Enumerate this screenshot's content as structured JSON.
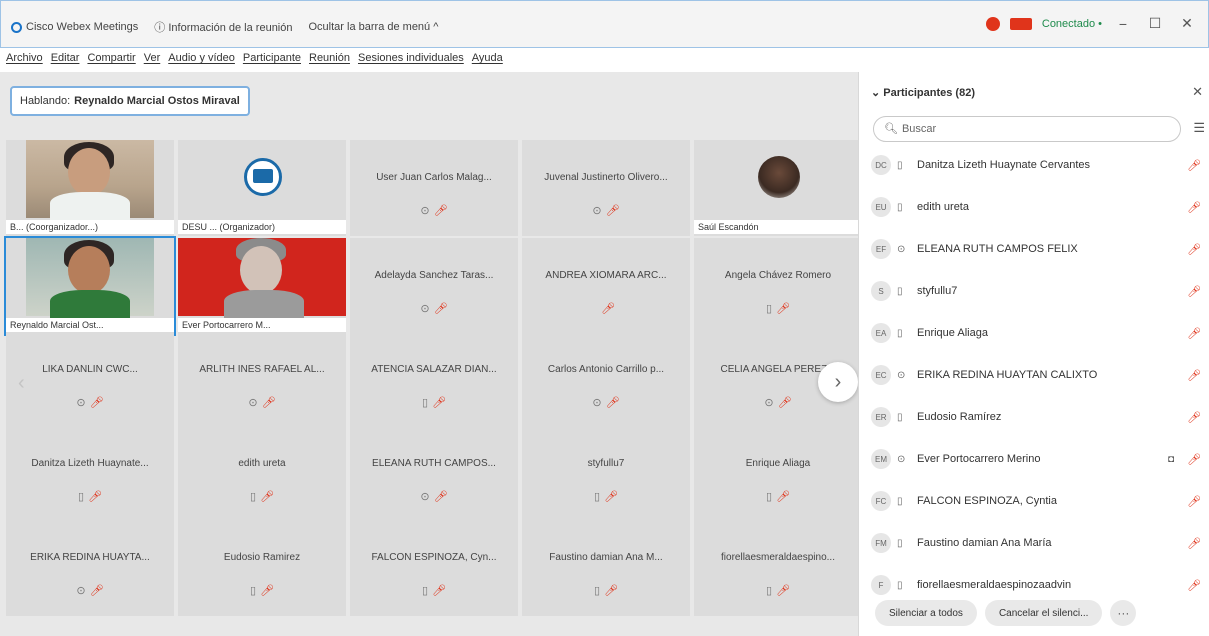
{
  "titlebar": {
    "app": "Cisco Webex Meetings",
    "info": "Información de la reunión",
    "hide_menu": "Ocultar la barra de menú ^",
    "status": "Conectado •",
    "min": "−",
    "max": "☐",
    "close": "✕"
  },
  "menu": [
    "Archivo",
    "Editar",
    "Compartir",
    "Ver",
    "Audio y vídeo",
    "Participante",
    "Reunión",
    "Sesiones individuales",
    "Ayuda"
  ],
  "speaker": {
    "label": "Hablando:",
    "name": "Reynaldo Marcial Ostos Miraval"
  },
  "tiles": [
    {
      "name": "B... (Coorganizador...)",
      "icons": "",
      "video": "person"
    },
    {
      "name": "DESU ... (Organizador)",
      "icons": "",
      "video": "logo"
    },
    {
      "name": "User Juan Carlos Malag...",
      "icons": "⊙"
    },
    {
      "name": "Juvenal Justinerto Olivero...",
      "icons": "⊙"
    },
    {
      "name": "Saúl Escandón",
      "icons": "",
      "video": "avatar"
    },
    {
      "name": "Reynaldo Marcial Ost...",
      "icons": "",
      "video": "green"
    },
    {
      "name": "Ever Portocarrero M...",
      "icons": "",
      "video": "red"
    },
    {
      "name": "Adelayda Sanchez Taras...",
      "icons": "⊙"
    },
    {
      "name": "ANDREA XIOMARA ARC...",
      "icons": ""
    },
    {
      "name": "Angela Chávez Romero",
      "icons": "▯"
    },
    {
      "name": "LIKA DANLIN CWC...",
      "icons": "⊙"
    },
    {
      "name": "ARLITH INES RAFAEL AL...",
      "icons": "⊙"
    },
    {
      "name": "ATENCIA SALAZAR DIAN...",
      "icons": "▯"
    },
    {
      "name": "Carlos Antonio Carrillo p...",
      "icons": "⊙"
    },
    {
      "name": "CELIA ANGELA PEREZ...",
      "icons": "⊙"
    },
    {
      "name": "Danitza Lizeth Huaynate...",
      "icons": "▯"
    },
    {
      "name": "edith ureta",
      "icons": "▯"
    },
    {
      "name": "ELEANA RUTH CAMPOS...",
      "icons": "⊙"
    },
    {
      "name": "styfullu7",
      "icons": "▯"
    },
    {
      "name": "Enrique Aliaga",
      "icons": "▯"
    },
    {
      "name": "ERIKA REDINA HUAYTA...",
      "icons": "⊙"
    },
    {
      "name": "Eudosio Ramirez",
      "icons": "▯"
    },
    {
      "name": "FALCON ESPINOZA, Cyn...",
      "icons": "▯"
    },
    {
      "name": "Faustino damian Ana M...",
      "icons": "▯"
    },
    {
      "name": "fiorellaesmeraldaespino...",
      "icons": "▯"
    }
  ],
  "nav": {
    "next": "›",
    "prev": "‹"
  },
  "panel": {
    "title": "Participantes (82)",
    "search_placeholder": "Buscar",
    "participants": [
      {
        "initials": "DC",
        "dev": "▯",
        "name": "Danitza Lizeth Huaynate Cervantes",
        "cam": ""
      },
      {
        "initials": "EU",
        "dev": "▯",
        "name": "edith ureta",
        "cam": ""
      },
      {
        "initials": "EF",
        "dev": "⊙",
        "name": "ELEANA RUTH CAMPOS FELIX",
        "cam": ""
      },
      {
        "initials": "S",
        "dev": "▯",
        "name": "styfullu7",
        "cam": ""
      },
      {
        "initials": "EA",
        "dev": "▯",
        "name": "Enrique Aliaga",
        "cam": ""
      },
      {
        "initials": "EC",
        "dev": "⊙",
        "name": "ERIKA REDINA HUAYTAN CALIXTO",
        "cam": ""
      },
      {
        "initials": "ER",
        "dev": "▯",
        "name": "Eudosio Ramírez",
        "cam": ""
      },
      {
        "initials": "EM",
        "dev": "⊙",
        "name": "Ever Portocarrero Merino",
        "cam": "◘"
      },
      {
        "initials": "FC",
        "dev": "▯",
        "name": "FALCON ESPINOZA, Cyntia",
        "cam": ""
      },
      {
        "initials": "FM",
        "dev": "▯",
        "name": "Faustino damian Ana María",
        "cam": ""
      },
      {
        "initials": "F",
        "dev": "▯",
        "name": "fiorellaesmeraldaespinozaadvin",
        "cam": ""
      }
    ],
    "mute_all": "Silenciar a todos",
    "unmute_all": "Cancelar el silenci...",
    "more": "···"
  },
  "colors": {
    "accent": "#2a8bd8",
    "mute": "#e0341b",
    "connected": "#1f8b4c"
  }
}
